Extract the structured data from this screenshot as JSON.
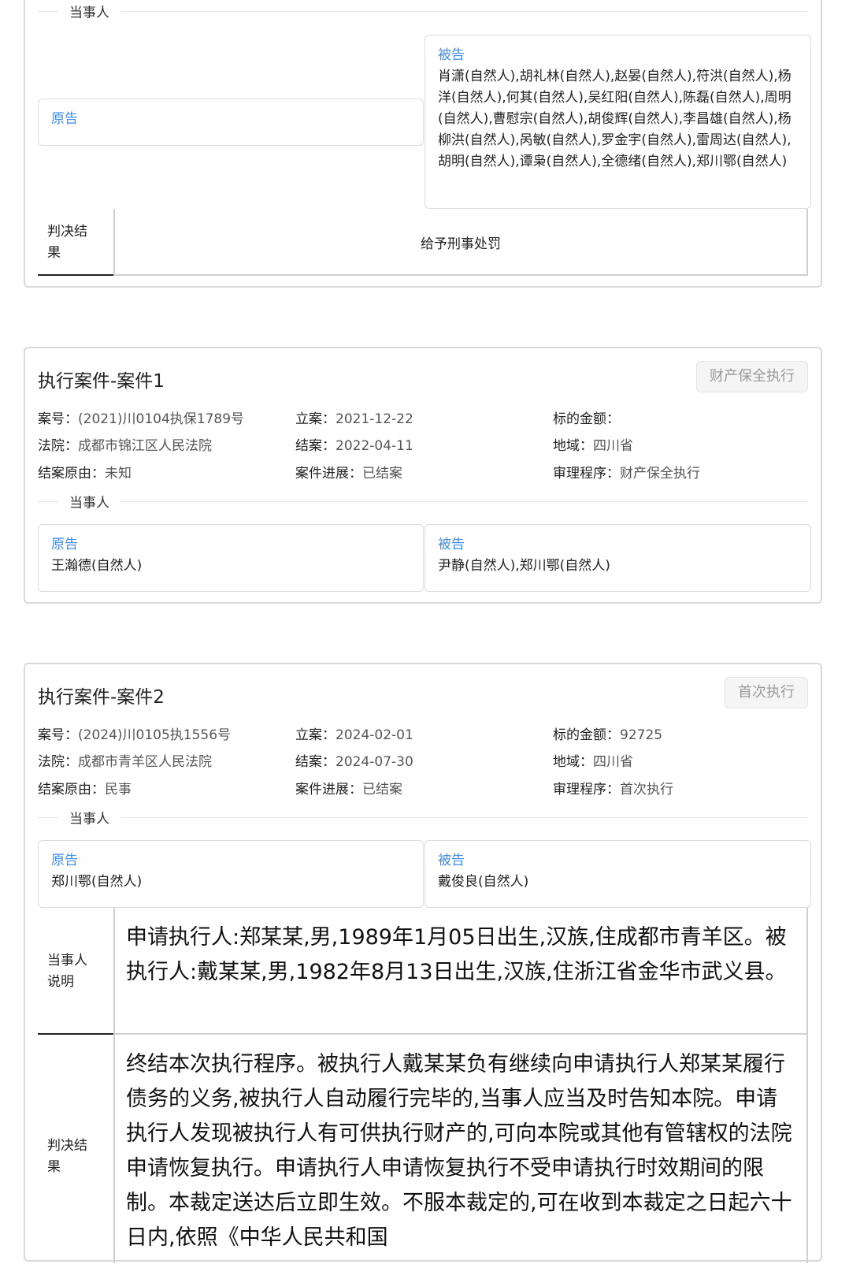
{
  "section_parties_label": "当事人",
  "labels": {
    "plaintiff": "原告",
    "defendant": "被告",
    "judgment": "判决结果",
    "party_desc": "当事人说明",
    "case_no": "案号：",
    "court": "法院：",
    "close_reason": "结案原由：",
    "filed": "立案：",
    "closed": "结案：",
    "progress": "案件进展：",
    "amount": "标的金额：",
    "region": "地域：",
    "procedure": "审理程序："
  },
  "top_case": {
    "plaintiff": "",
    "defendant": "肖潇(自然人),胡礼林(自然人),赵晏(自然人),符洪(自然人),杨洋(自然人),何其(自然人),吴红阳(自然人),陈磊(自然人),周明(自然人),曹慰宗(自然人),胡俊辉(自然人),李昌雄(自然人),杨柳洪(自然人),呙敏(自然人),罗金宇(自然人),雷周达(自然人),胡明(自然人),谭枭(自然人),全德绪(自然人),郑川鄂(自然人)",
    "judgment": "给予刑事处罚"
  },
  "case1": {
    "title": "执行案件-案件1",
    "tag": "财产保全执行",
    "case_no": "(2021)川0104执保1789号",
    "court": "成都市锦江区人民法院",
    "close_reason": "未知",
    "filed": "2021-12-22",
    "closed": "2022-04-11",
    "progress": "已结案",
    "amount": "",
    "region": "四川省",
    "procedure": "财产保全执行",
    "plaintiff": "王瀚德(自然人)",
    "defendant": "尹静(自然人),郑川鄂(自然人)"
  },
  "case2": {
    "title": "执行案件-案件2",
    "tag": "首次执行",
    "case_no": "(2024)川0105执1556号",
    "court": "成都市青羊区人民法院",
    "close_reason": "民事",
    "filed": "2024-02-01",
    "closed": "2024-07-30",
    "progress": "已结案",
    "amount": "92725",
    "region": "四川省",
    "procedure": "首次执行",
    "plaintiff": "郑川鄂(自然人)",
    "defendant": "戴俊良(自然人)",
    "party_desc": "申请执行人:郑某某,男,1989年1月05日出生,汉族,住成都市青羊区。被执行人:戴某某,男,1982年8月13日出生,汉族,住浙江省金华市武义县。",
    "judgment": "终结本次执行程序。被执行人戴某某负有继续向申请执行人郑某某履行债务的义务,被执行人自动履行完毕的,当事人应当及时告知本院。申请执行人发现被执行人有可供执行财产的,可向本院或其他有管辖权的法院申请恢复执行。申请执行人申请恢复执行不受申请执行时效期间的限制。本裁定送达后立即生效。不服本裁定的,可在收到本裁定之日起六十日内,依照《中华人民共和国"
  }
}
